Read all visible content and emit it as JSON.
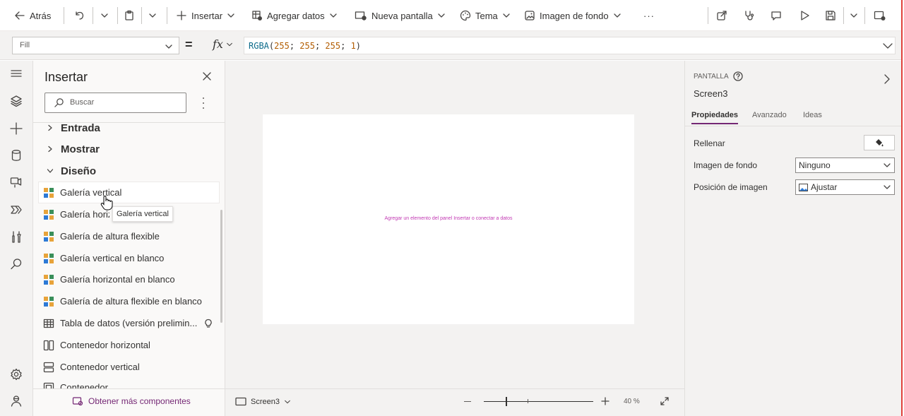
{
  "toolbar": {
    "back_label": "Atrás",
    "insert_label": "Insertar",
    "add_data_label": "Agregar datos",
    "new_screen_label": "Nueva pantalla",
    "theme_label": "Tema",
    "bg_image_label": "Imagen de fondo",
    "more_label": "···"
  },
  "formula_bar": {
    "property": "Fill",
    "equals": "=",
    "fx": "fx",
    "formula": "RGBA(255; 255; 255; 1)"
  },
  "insert_panel": {
    "title": "Insertar",
    "search_placeholder": "Buscar",
    "categories": [
      "Entrada",
      "Mostrar",
      "Diseño"
    ],
    "items": [
      {
        "label": "Galería vertical",
        "icon": "gallery-icon"
      },
      {
        "label": "Galería horizontal",
        "icon": "gallery-icon"
      },
      {
        "label": "Galería de altura flexible",
        "icon": "gallery-icon"
      },
      {
        "label": "Galería vertical en blanco",
        "icon": "gallery-icon"
      },
      {
        "label": "Galería horizontal en blanco",
        "icon": "gallery-icon"
      },
      {
        "label": "Galería de altura flexible en blanco",
        "icon": "gallery-icon"
      },
      {
        "label": "Tabla de datos (versión prelimin...",
        "icon": "table-icon"
      },
      {
        "label": "Contenedor horizontal",
        "icon": "horizontal-container-icon"
      },
      {
        "label": "Contenedor vertical",
        "icon": "vertical-container-icon"
      },
      {
        "label": "Contenedor",
        "icon": "container-icon"
      }
    ],
    "tooltip": "Galería vertical",
    "get_more": "Obtener más componentes"
  },
  "canvas": {
    "hint": "Agregar un elemento del panel Insertar o conectar a datos",
    "screen_name": "Screen3",
    "zoom": "40 %",
    "zoom_fraction": 0.2
  },
  "properties_panel": {
    "section": "PANTALLA",
    "screen_name": "Screen3",
    "tabs": [
      "Propiedades",
      "Avanzado",
      "Ideas"
    ],
    "active_tab": "Propiedades",
    "rows": {
      "fill_label": "Rellenar",
      "bg_image_label": "Imagen de fondo",
      "bg_image_value": "Ninguno",
      "image_position_label": "Posición de imagen",
      "image_position_value": "Ajustar"
    }
  },
  "colors": {
    "accent": "#742774",
    "hint_text": "#c239b3",
    "formula_fn": "#0b6a8a",
    "formula_num": "#b25c00"
  }
}
